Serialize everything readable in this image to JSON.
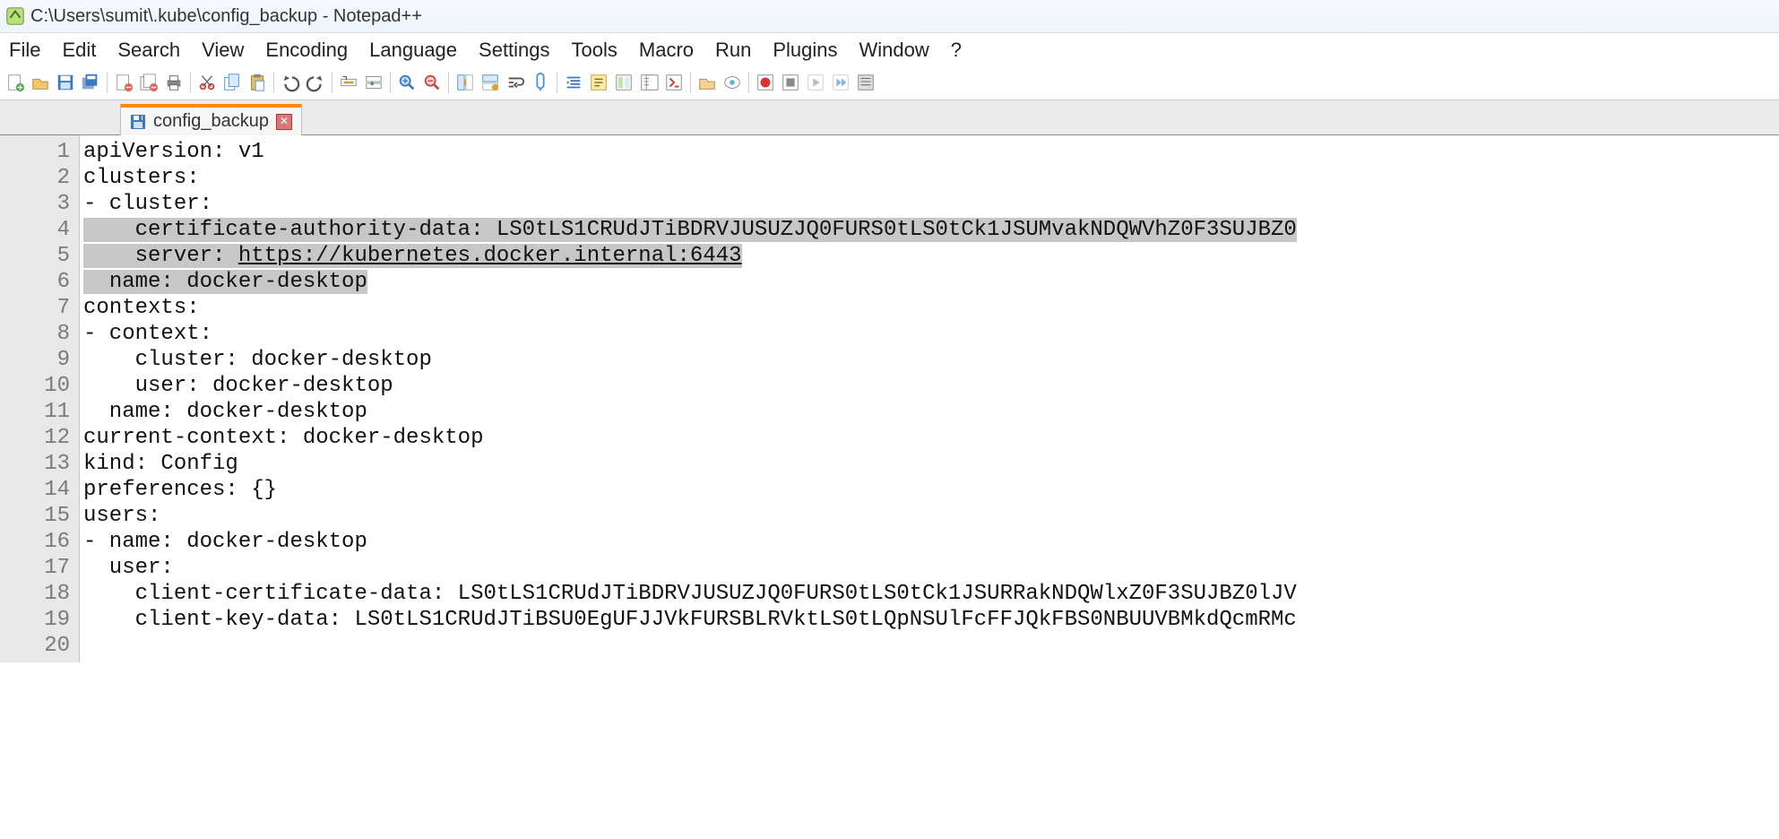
{
  "window": {
    "title": "C:\\Users\\sumit\\.kube\\config_backup - Notepad++"
  },
  "menus": [
    "File",
    "Edit",
    "Search",
    "View",
    "Encoding",
    "Language",
    "Settings",
    "Tools",
    "Macro",
    "Run",
    "Plugins",
    "Window",
    "?"
  ],
  "toolbar_icons": [
    "new-file-icon",
    "open-file-icon",
    "save-icon",
    "save-all-icon",
    "sep",
    "close-file-icon",
    "close-all-icon",
    "print-icon",
    "sep",
    "cut-icon",
    "copy-icon",
    "paste-icon",
    "sep",
    "undo-icon",
    "redo-icon",
    "sep",
    "find-icon",
    "replace-icon",
    "sep",
    "zoom-in-icon",
    "zoom-out-icon",
    "sep",
    "sync-v-icon",
    "sync-h-icon",
    "wrap-icon",
    "show-all-chars-icon",
    "sep",
    "indent-guide-icon",
    "udl-icon",
    "doc-map-icon",
    "doc-list-icon",
    "function-list-icon",
    "sep",
    "folder-icon",
    "monitor-icon",
    "sep",
    "record-macro-icon",
    "stop-macro-icon",
    "play-macro-icon",
    "play-multi-icon",
    "save-macro-icon"
  ],
  "tab": {
    "label": "config_backup"
  },
  "code": {
    "lines": [
      {
        "n": 1,
        "pre": "",
        "text": "apiVersion: v1"
      },
      {
        "n": 2,
        "pre": "",
        "text": "clusters:"
      },
      {
        "n": 3,
        "pre": "",
        "text": "- cluster:"
      },
      {
        "n": 4,
        "pre": "    ",
        "sel": "certificate-authority-data: LS0tLS1CRUdJTiBDRVJUSUZJQ0FURS0tLS0tCk1JSUMvakNDQWVhZ0F3SUJBZ0"
      },
      {
        "n": 5,
        "pre": "    ",
        "sel_prefix": "server: ",
        "url": "https://kubernetes.docker.internal:6443"
      },
      {
        "n": 6,
        "pre": "  ",
        "sel": "name: docker-desktop"
      },
      {
        "n": 7,
        "pre": "",
        "text": "contexts:"
      },
      {
        "n": 8,
        "pre": "",
        "text": "- context:"
      },
      {
        "n": 9,
        "pre": "",
        "text": "    cluster: docker-desktop"
      },
      {
        "n": 10,
        "pre": "",
        "text": "    user: docker-desktop"
      },
      {
        "n": 11,
        "pre": "",
        "text": "  name: docker-desktop"
      },
      {
        "n": 12,
        "pre": "",
        "text": "current-context: docker-desktop"
      },
      {
        "n": 13,
        "pre": "",
        "text": "kind: Config"
      },
      {
        "n": 14,
        "pre": "",
        "text": "preferences: {}"
      },
      {
        "n": 15,
        "pre": "",
        "text": "users:"
      },
      {
        "n": 16,
        "pre": "",
        "text": "- name: docker-desktop"
      },
      {
        "n": 17,
        "pre": "",
        "text": "  user:"
      },
      {
        "n": 18,
        "pre": "",
        "text": "    client-certificate-data: LS0tLS1CRUdJTiBDRVJUSUZJQ0FURS0tLS0tCk1JSURRakNDQWlxZ0F3SUJBZ0lJV"
      },
      {
        "n": 19,
        "pre": "",
        "text": "    client-key-data: LS0tLS1CRUdJTiBSU0EgUFJJVkFURSBLRVktLS0tLQpNSUlFcFFJQkFBS0NBUUVBMkdQcmRMc"
      },
      {
        "n": 20,
        "pre": "",
        "text": ""
      }
    ]
  }
}
